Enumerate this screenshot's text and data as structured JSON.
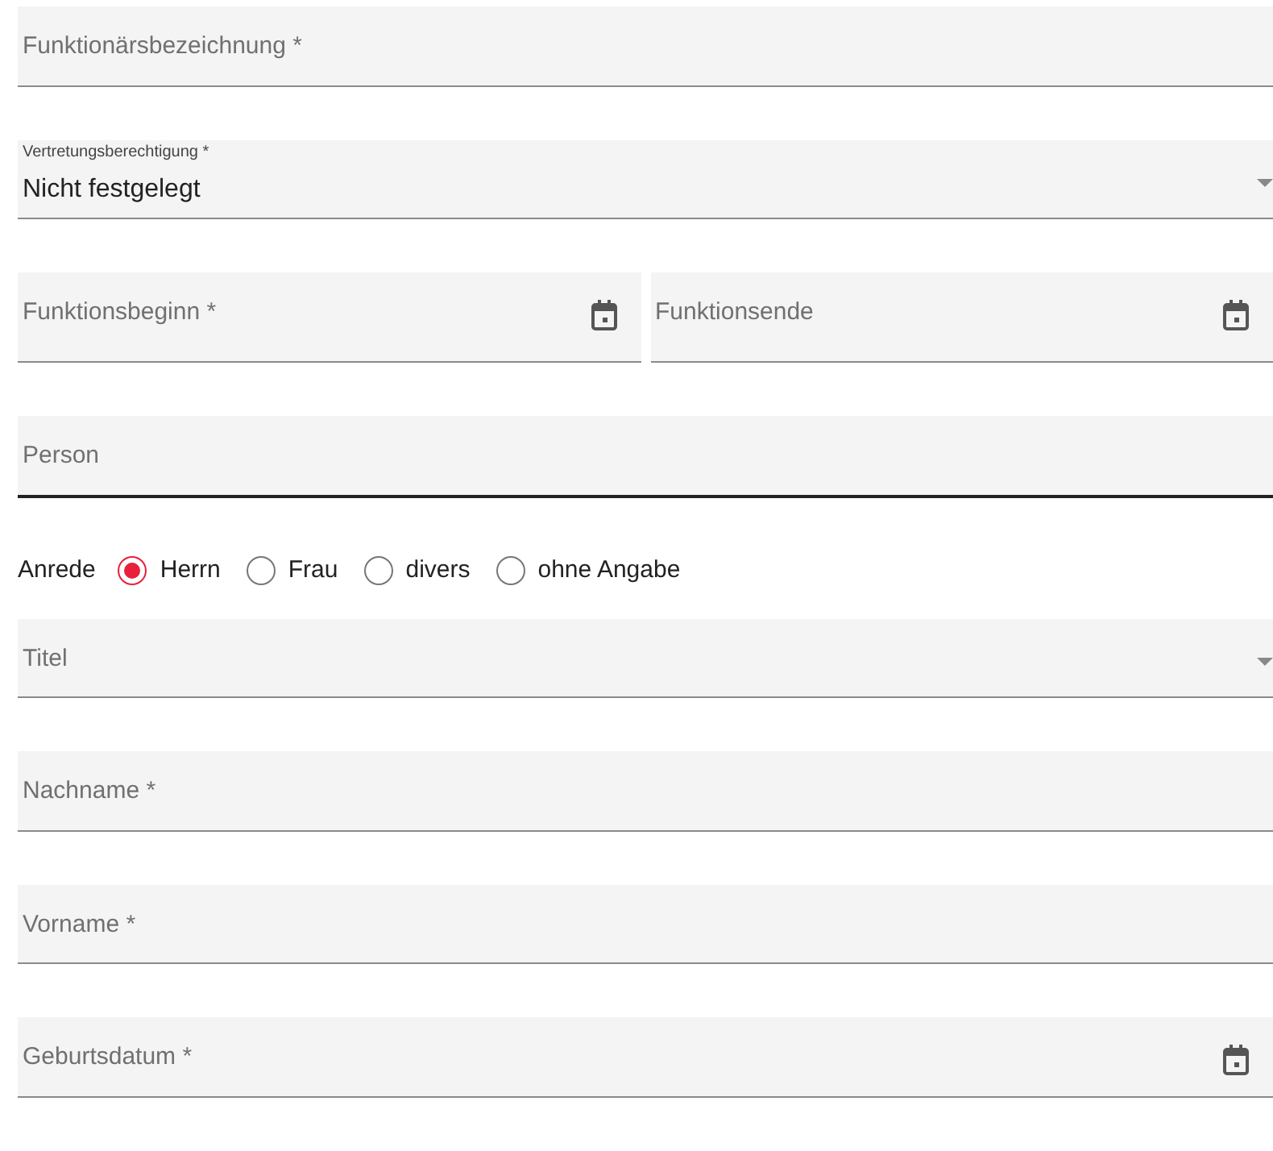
{
  "rows": [
    {
      "kind": "text",
      "label": "Funktionärsbezeichnung *",
      "focused": false
    },
    {
      "kind": "select",
      "label": "Vertretungsberechtigung *",
      "value": "Nicht festgelegt",
      "focused": false
    },
    {
      "kind": "pair",
      "fields": [
        {
          "kind": "date",
          "label": "Funktionsbeginn *",
          "focused": false
        },
        {
          "kind": "date",
          "label": "Funktionsende",
          "focused": false
        }
      ]
    },
    {
      "kind": "text",
      "label": "Person",
      "focused": true
    },
    {
      "kind": "radio",
      "label": "Anrede",
      "options": [
        {
          "label": "Herrn",
          "selected": true
        },
        {
          "label": "Frau",
          "selected": false
        },
        {
          "label": "divers",
          "selected": false
        },
        {
          "label": "ohne Angabe",
          "selected": false
        }
      ]
    },
    {
      "kind": "select",
      "label": "Titel",
      "focused": false
    },
    {
      "kind": "text",
      "label": "Nachname *",
      "focused": false
    },
    {
      "kind": "text",
      "label": "Vorname *",
      "focused": false
    },
    {
      "kind": "date",
      "label": "Geburtsdatum *",
      "focused": false
    }
  ]
}
